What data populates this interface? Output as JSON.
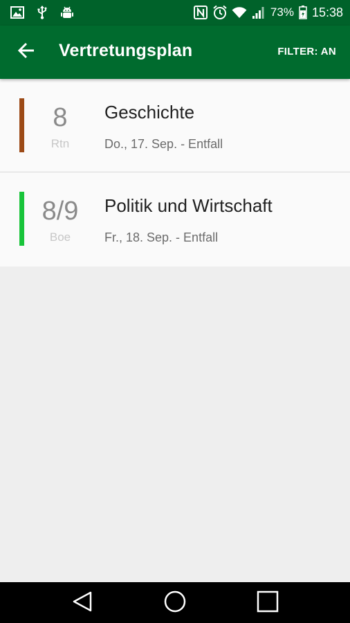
{
  "status_bar": {
    "left_icons": [
      "gallery-icon",
      "usb-icon",
      "android-debug-icon"
    ],
    "right_icons": [
      "nfc-icon",
      "alarm-icon",
      "wifi-icon",
      "signal-icon",
      "battery-icon"
    ],
    "battery": "73%",
    "time": "15:38"
  },
  "app_bar": {
    "back_icon": "arrow-left-icon",
    "title": "Vertretungsplan",
    "filter_label": "FILTER: AN"
  },
  "entries": [
    {
      "lesson": "8",
      "teacher": "Rtn",
      "subject": "Geschichte",
      "info": "Do., 17. Sep. - Entfall",
      "color": "#9c4a17"
    },
    {
      "lesson": "8/9",
      "teacher": "Boe",
      "subject": "Politik und Wirtschaft",
      "info": "Fr., 18. Sep. - Entfall",
      "color": "#18c43a"
    }
  ],
  "nav_bar": {
    "back": "triangle-back-icon",
    "home": "circle-home-icon",
    "recents": "square-recents-icon"
  }
}
